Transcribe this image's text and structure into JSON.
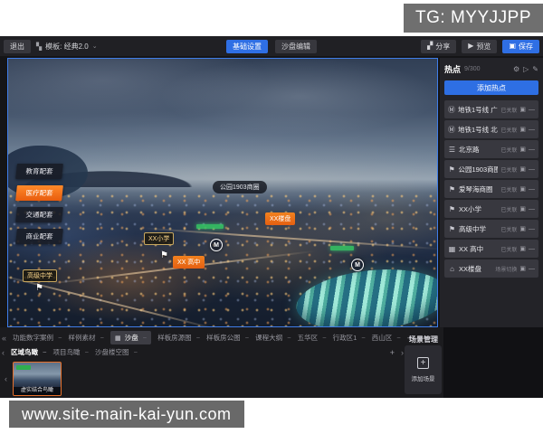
{
  "watermarks": {
    "top": "TG: MYYJJPP",
    "bottom": "www.site-main-kai-yun.com"
  },
  "toolbar": {
    "exit": "退出",
    "template": "模板: 经典2.0",
    "base_settings": "基础设置",
    "sandbox_edit": "沙盘编辑",
    "share": "分享",
    "preview": "预览",
    "save": "保存"
  },
  "map": {
    "category_buttons": [
      {
        "label": "教育配套",
        "active": false
      },
      {
        "label": "医疗配套",
        "active": true
      },
      {
        "label": "交通配套",
        "active": false
      },
      {
        "label": "商业配套",
        "active": false
      }
    ],
    "labels": [
      {
        "text": "公园1903商圈",
        "type": "dark",
        "pos": "park"
      },
      {
        "text": "XX楼盘",
        "type": "orange",
        "pos": "estate"
      },
      {
        "text": "XX小学",
        "type": "gold",
        "pos": "school"
      },
      {
        "text": "XX 高中",
        "type": "orange",
        "pos": "xxhigh"
      },
      {
        "text": "高级中学",
        "type": "gold",
        "pos": "middle"
      }
    ]
  },
  "hotspot_panel": {
    "title": "热点",
    "count": "9/300",
    "add_button": "添加热点",
    "items": [
      {
        "icon": "metro-icon",
        "label": "地铁1号线 广…",
        "status": "已关联"
      },
      {
        "icon": "metro-icon",
        "label": "地铁1号线 北…",
        "status": "已关联"
      },
      {
        "icon": "road-icon",
        "label": "北京路",
        "status": "已关联"
      },
      {
        "icon": "flag-icon",
        "label": "公园1903商圈",
        "status": "已关联"
      },
      {
        "icon": "flag-icon",
        "label": "爱琴海商圈",
        "status": "已关联"
      },
      {
        "icon": "flag-icon",
        "label": "XX小学",
        "status": "已关联"
      },
      {
        "icon": "flag-icon",
        "label": "高级中学",
        "status": "已关联"
      },
      {
        "icon": "school-icon",
        "label": "XX 高中",
        "status": "已关联"
      },
      {
        "icon": "estate-icon",
        "label": "XX楼盘",
        "status": "场景切换"
      }
    ]
  },
  "scene_tabs": {
    "row1": [
      {
        "label": "功能数字案例",
        "active": false
      },
      {
        "label": "样例素材",
        "active": false
      },
      {
        "label": "沙盘",
        "active": true,
        "icon": "grid-icon"
      },
      {
        "label": "样板房源图",
        "active": false
      },
      {
        "label": "样板房公图",
        "active": false
      },
      {
        "label": "课程大纲",
        "active": false
      },
      {
        "label": "五华区",
        "active": false
      },
      {
        "label": "行政区1",
        "active": false
      },
      {
        "label": "西山区",
        "active": false
      }
    ],
    "row2": [
      {
        "label": "区域鸟瞰",
        "active": true
      },
      {
        "label": "项目鸟瞰",
        "active": false
      },
      {
        "label": "沙盘楼空图",
        "active": false
      }
    ],
    "thumbnail_caption": "虚实结合鸟瞰"
  },
  "scene_manager": {
    "title": "场景管理",
    "add_scene": "添加场景"
  }
}
